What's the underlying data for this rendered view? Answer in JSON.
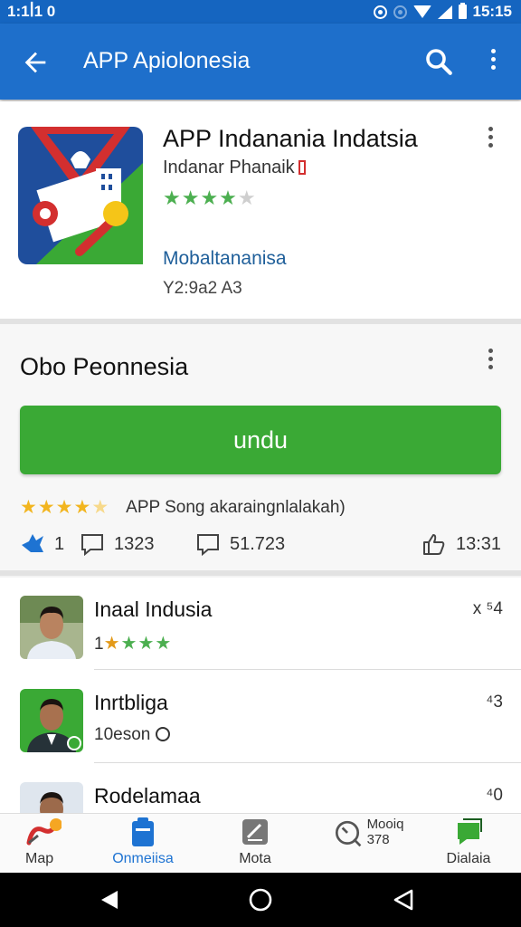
{
  "status_bar": {
    "time_left": "1:1ꟾ1 0",
    "time_right": "15:15"
  },
  "app_bar": {
    "title": "APP Apiolonesia"
  },
  "app": {
    "name": "APP Indanania Indatsia",
    "developer": "Indanar Phanaik",
    "rating_stars": 4,
    "category": "Mobaltananisa",
    "meta": "Y2:9a2 A3"
  },
  "install": {
    "title": "Obo Peonnesia",
    "button_label": "undu",
    "rating_stars": 4.5,
    "rating_text": "APP Song akaraingnlalakah)",
    "stats": {
      "likes": "1",
      "comments": "1323",
      "messages": "51.723",
      "thumbs": "13:31"
    }
  },
  "reviews": [
    {
      "name": "Inaal Indusia",
      "sub_prefix": "1",
      "meta": "x ⁵4"
    },
    {
      "name": "Inrtbliga",
      "sub": "10eson",
      "meta": "⁴3"
    },
    {
      "name": "Rodelamaa",
      "meta": "⁴0"
    }
  ],
  "bottom_nav": [
    {
      "label": "Map"
    },
    {
      "label": "Onmeiisa"
    },
    {
      "label": "Mota"
    },
    {
      "label": "Mooiq",
      "sub": "378"
    },
    {
      "label": "Dialaia"
    }
  ],
  "colors": {
    "primary": "#1e6fcb",
    "status_bar": "#1565c0",
    "install_button": "#3aa935",
    "star_green": "#4caf50",
    "star_gold": "#f2b51f",
    "nav_active": "#1e73d2"
  }
}
